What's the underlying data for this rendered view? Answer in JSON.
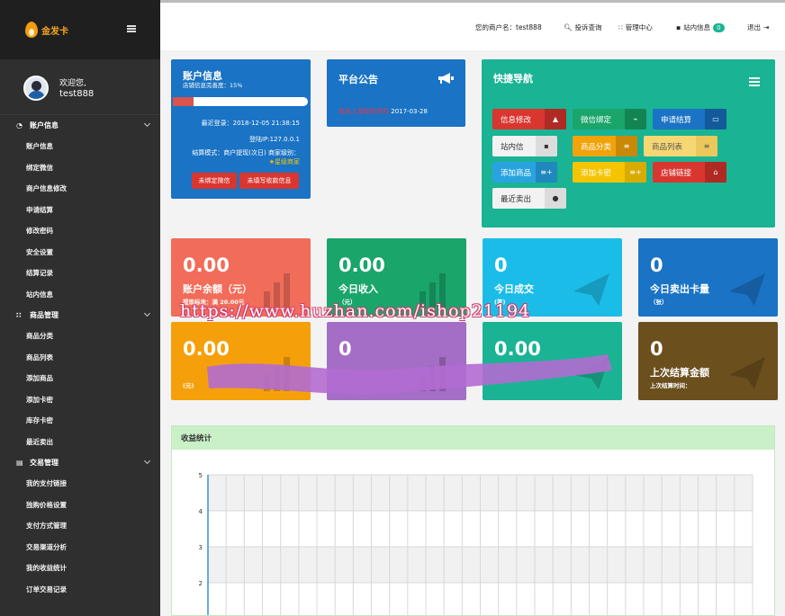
{
  "sidebar": {
    "logo_text": "金发卡",
    "welcome": "欢迎您,",
    "username": "test888",
    "groups": [
      {
        "label": "账户信息",
        "icon": "gauge-icon",
        "items": [
          "账户信息",
          "绑定微信",
          "商户信息修改",
          "申请结算",
          "修改密码",
          "安全设置",
          "结算记录",
          "站内信息"
        ]
      },
      {
        "label": "商品管理",
        "icon": "grid-icon",
        "items": [
          "商品分类",
          "商品列表",
          "添加商品",
          "添加卡密",
          "库存卡密",
          "最近卖出"
        ]
      },
      {
        "label": "交易管理",
        "icon": "document-icon",
        "items": [
          "我的支付链接",
          "独购价格设置",
          "支付方式管理",
          "交易渠道分析",
          "我的收益统计",
          "订单交易记录"
        ]
      }
    ]
  },
  "topbar": {
    "merchant": "您的商户名：test888",
    "query": "投诉查询",
    "manage": "管理中心",
    "messages": "站内信息",
    "message_count": "0",
    "logout": "退出"
  },
  "account_panel": {
    "title": "账户信息",
    "subtitle": "店铺信息完善度：15%",
    "completeness_percent": 15,
    "last_login": "最近登录：2018-12-05 21:38:15",
    "login_ip": "登陆IP:127.0.0.1",
    "settle_mode": "结算模式：商户提现(次日) 商家级别：",
    "level": "★星级商家",
    "btn_wechat": "未绑定微信",
    "btn_payout": "未填写收款信息"
  },
  "notice_panel": {
    "title": "平台公告",
    "notice_text": "商品上架规则须知",
    "notice_date": "2017-03-28"
  },
  "quick_nav": {
    "title": "快捷导航",
    "buttons": [
      {
        "label": "信息修改",
        "icon": "user-icon",
        "bg": "#d9362f",
        "ibg": "#b02a24",
        "fg": "#ffffff"
      },
      {
        "label": "微信绑定",
        "icon": "link-icon",
        "bg": "#1aa56b",
        "ibg": "#138553",
        "fg": "#ffffff"
      },
      {
        "label": "申请结算",
        "icon": "card-icon",
        "bg": "#1a73c4",
        "ibg": "#135a9b",
        "fg": "#ffffff"
      },
      {
        "label": "站内信",
        "icon": "chat-icon",
        "bg": "#f2f2f2",
        "ibg": "#dcdcdc",
        "fg": "#333333"
      },
      {
        "label": "商品分类",
        "icon": "list-icon",
        "bg": "#f0a30a",
        "ibg": "#c98807",
        "fg": "#ffffff"
      },
      {
        "label": "商品列表",
        "icon": "lines-icon",
        "bg": "#f7d774",
        "ibg": "#eac85c",
        "fg": "#555555"
      },
      {
        "label": "添加商品",
        "icon": "plus-list-icon",
        "bg": "#29a3e0",
        "ibg": "#1f88bd",
        "fg": "#ffffff"
      },
      {
        "label": "添加卡密",
        "icon": "plus-list-icon",
        "bg": "#f5c400",
        "ibg": "#d7ab00",
        "fg": "#ffffff"
      },
      {
        "label": "店铺链接",
        "icon": "home-icon",
        "bg": "#d9362f",
        "ibg": "#b02a24",
        "fg": "#ffffff"
      },
      {
        "label": "最近卖出",
        "icon": "bell-icon",
        "bg": "#f2f2f2",
        "ibg": "#dcdcdc",
        "fg": "#333333"
      }
    ]
  },
  "stats": [
    {
      "value": "0.00",
      "label": "账户余额（元）",
      "sub": "提现标准：满 20.00元",
      "color": "#f26c5a"
    },
    {
      "value": "0.00",
      "label": "今日收入",
      "sub": "（元）",
      "color": "#1aa56b"
    },
    {
      "value": "0",
      "label": "今日成交",
      "sub": "(笔)",
      "color": "#1bbde8"
    },
    {
      "value": "0",
      "label": "今日卖出卡量",
      "sub": "（张）",
      "color": "#1a73c4"
    },
    {
      "value": "0.00",
      "label": "",
      "sub": "(元)",
      "color": "#f5a00a"
    },
    {
      "value": "0",
      "label": "",
      "sub": "",
      "color": "#a46ec6"
    },
    {
      "value": "0.00",
      "label": "",
      "sub": "",
      "color": "#1ab394"
    },
    {
      "value": "0",
      "label": "上次结算金额",
      "sub": "上次结算时间：",
      "color": "#6b4f1d"
    }
  ],
  "chart_title": "收益统计",
  "chart_data": {
    "type": "line",
    "title": "收益统计",
    "ylim": [
      1,
      5
    ],
    "y_ticks": [
      "5",
      "4",
      "3",
      "2"
    ],
    "series": [],
    "grid": true
  },
  "watermark": "https://www.huzhan.com/ishop21194"
}
